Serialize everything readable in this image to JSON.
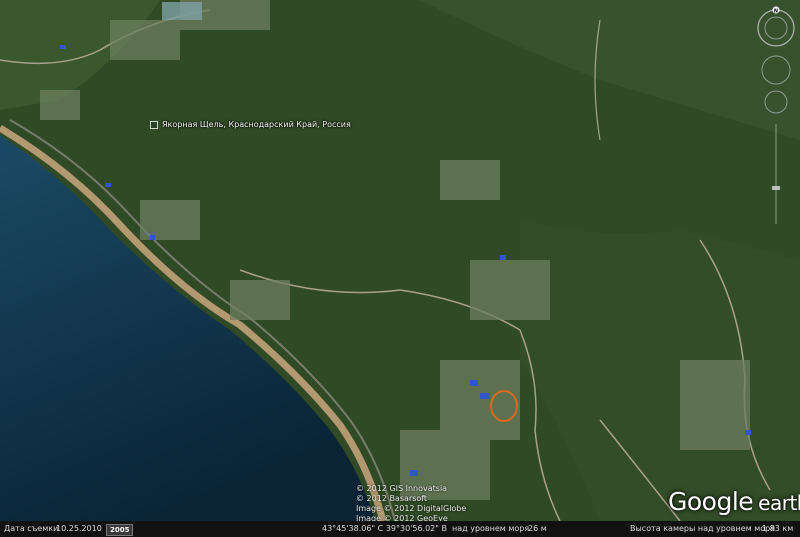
{
  "placemark": {
    "label": "Якорная Щель, Краснодарский Край, Россия"
  },
  "attribution": [
    "© 2012 GIS Innovatsia",
    "© 2012 Basarsoft",
    "Image © 2012 DigitalGlobe",
    "Image © 2012 GeoEye"
  ],
  "logo": {
    "google": "Google",
    "earth": "earth"
  },
  "status_bar": {
    "date_label": "Дата съемки",
    "date": "10.25.2010",
    "year": "2005",
    "coordinates": "43°45'38.06\" С  39°30'56.02\" В",
    "elevation_label": "над уровнем моря",
    "elevation": "26 м",
    "eye_label": "Высота камеры над уровнем моря",
    "eye_alt": "1.83 км"
  },
  "navigation": {
    "north": "N"
  },
  "colors": {
    "sea": "#0d2f45",
    "forest": "#2f4a25",
    "beach": "#c9a77f",
    "highlight_circle": "#d86a1c"
  }
}
